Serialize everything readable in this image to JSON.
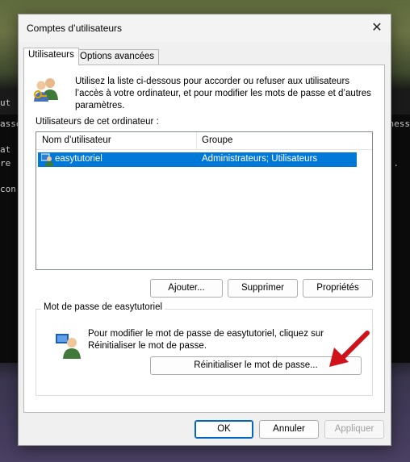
{
  "background": {
    "console_lines_left": [
      "ut",
      "asse",
      "at",
      "re",
      "con"
    ],
    "console_lines_right": [
      "ness",
      "."
    ]
  },
  "dialog": {
    "title": "Comptes d’utilisateurs",
    "close_glyph": "✕",
    "tabs": [
      {
        "label": "Utilisateurs",
        "active": true
      },
      {
        "label": "Options avancées",
        "active": false
      }
    ],
    "intro_text": "Utilisez la liste ci-dessous pour accorder ou refuser aux utilisateurs l’accès à votre ordinateur, et pour modifier les mots de passe et d’autres paramètres.",
    "list_caption": "Utilisateurs de cet ordinateur :",
    "columns": [
      "Nom d’utilisateur",
      "Groupe"
    ],
    "rows": [
      {
        "name": "easytutoriel",
        "group": "Administrateurs; Utilisateurs",
        "selected": true
      }
    ],
    "buttons": {
      "add": "Ajouter...",
      "remove": "Supprimer",
      "properties": "Propriétés",
      "reset_password": "Réinitialiser le mot de passe...",
      "ok": "OK",
      "cancel": "Annuler",
      "apply": "Appliquer"
    },
    "password_group": {
      "legend": "Mot de passe de easytutoriel",
      "text": "Pour modifier le mot de passe de easytutoriel, cliquez sur Réinitialiser le mot de passe."
    }
  },
  "colors": {
    "selection": "#0078d7",
    "arrow": "#d0121b",
    "default_button_border": "#0067c0"
  },
  "icons": [
    "users-icon",
    "user-row-icon",
    "user-key-icon",
    "close-icon",
    "red-arrow"
  ]
}
